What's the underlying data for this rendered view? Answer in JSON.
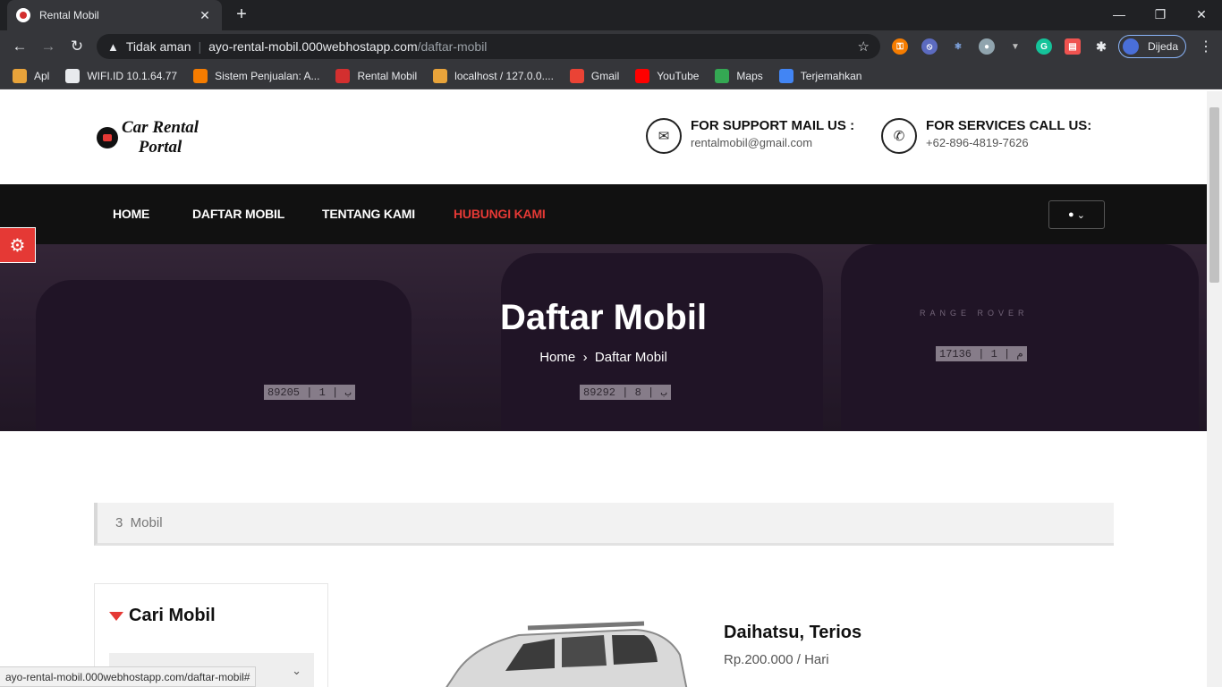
{
  "browser": {
    "tab_title": "Rental Mobil",
    "security_label": "Tidak aman",
    "url_host": "ayo-rental-mobil.000webhostapp.com",
    "url_path": "/daftar-mobil",
    "profile_name": "Dijeda",
    "status_url": "ayo-rental-mobil.000webhostapp.com/daftar-mobil#",
    "bookmarks": [
      {
        "label": "Apl",
        "icon": "apps-grid-icon",
        "color": "#e8a33a"
      },
      {
        "label": "WIFI.ID 10.1.64.77",
        "icon": "globe-icon",
        "color": "#e8eaed"
      },
      {
        "label": "Sistem Penjualan: A...",
        "icon": "xampp-icon",
        "color": "#f57c00"
      },
      {
        "label": "Rental Mobil",
        "icon": "rental-favicon",
        "color": "#d32f2f"
      },
      {
        "label": "localhost / 127.0.0....",
        "icon": "phpmyadmin-icon",
        "color": "#e8a33a"
      },
      {
        "label": "Gmail",
        "icon": "gmail-icon",
        "color": "#ea4335"
      },
      {
        "label": "YouTube",
        "icon": "youtube-icon",
        "color": "#ff0000"
      },
      {
        "label": "Maps",
        "icon": "maps-icon",
        "color": "#34a853"
      },
      {
        "label": "Terjemahkan",
        "icon": "translate-icon",
        "color": "#4285f4"
      }
    ]
  },
  "site": {
    "logo_line1": "Car Rental",
    "logo_line2": "Portal",
    "support_label": "FOR SUPPORT MAIL US :",
    "support_email": "rentalmobil@gmail.com",
    "services_label": "FOR SERVICES CALL US:",
    "services_phone": "+62-896-4819-7626"
  },
  "nav": {
    "items": [
      {
        "label": "HOME"
      },
      {
        "label": "DAFTAR MOBIL"
      },
      {
        "label": "TENTANG KAMI"
      },
      {
        "label": "HUBUNGI KAMI"
      }
    ],
    "accent": "#e53935"
  },
  "hero": {
    "title": "Daftar Mobil",
    "breadcrumb_home": "Home",
    "breadcrumb_current": "Daftar Mobil",
    "plates": [
      "89205 | ب | 1",
      "89292 | ب | 8",
      "17136 | م | 1"
    ],
    "brand_text": "RANGE ROVER"
  },
  "listing": {
    "count_text": "3  Mobil",
    "filter_title": "Cari Mobil",
    "car_name": "Daihatsu, Terios",
    "car_price": "Rp.200.000 / Hari"
  }
}
